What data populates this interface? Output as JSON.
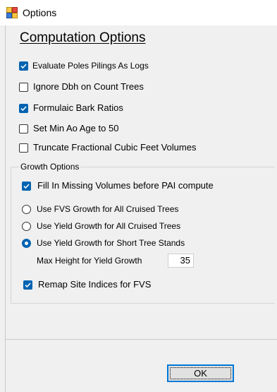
{
  "window": {
    "title": "Options",
    "icon": "options-app-icon"
  },
  "computation": {
    "heading": "Computation Options",
    "options": [
      {
        "label": "Evaluate Poles  Pilings As Logs",
        "checked": true
      },
      {
        "label": "Ignore Dbh on Count Trees",
        "checked": false
      },
      {
        "label": "Formulaic Bark Ratios",
        "checked": true
      },
      {
        "label": "Set Min Ao Age to 50",
        "checked": false
      },
      {
        "label": "Truncate Fractional Cubic Feet Volumes",
        "checked": false
      }
    ]
  },
  "growth": {
    "legend": "Growth Options",
    "fill_missing": {
      "label": "Fill In Missing Volumes before PAI compute",
      "checked": true
    },
    "radios": [
      {
        "label": "Use FVS Growth for All Cruised Trees",
        "selected": false
      },
      {
        "label": "Use Yield Growth for All Cruised Trees",
        "selected": false
      },
      {
        "label": "Use Yield Growth for Short Tree Stands",
        "selected": true
      }
    ],
    "max_height": {
      "label": "Max Height for Yield Growth",
      "value": "35"
    },
    "remap": {
      "label": "Remap Site Indices for FVS",
      "checked": true
    }
  },
  "footer": {
    "ok_label": "OK"
  },
  "colors": {
    "accent": "#0063b1",
    "focus_border": "#0078d7",
    "background": "#f0f0f0"
  }
}
